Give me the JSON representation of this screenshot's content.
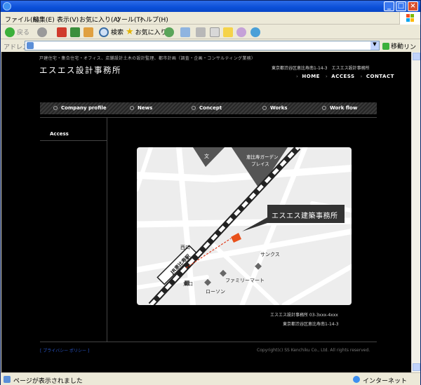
{
  "browser": {
    "menu": [
      "ファイル(F)",
      "編集(E)",
      "表示(V)",
      "お気に入り(A)",
      "ツール(T)",
      "ヘルプ(H)"
    ],
    "toolbar": {
      "back": "戻る",
      "search": "検索",
      "favorites": "お気に入り"
    },
    "address_label": "アドレス(D)",
    "address_value": "",
    "go_label": "移動",
    "links_label": "リンク",
    "status_text": "ページが表示されました",
    "zone_text": "インターネット"
  },
  "site": {
    "tagline": "戸建住宅・集合住宅・オフィス、店舗設計土木の設計監理、都市計画（調査・企画・コンサルティング業務）",
    "logo": "エスエス設計事務所",
    "address_top": "東京都渋谷区恵比寿南1-14-3　エスエス設計事務所",
    "topnav": [
      "HOME",
      "ACCESS",
      "CONTACT"
    ],
    "nav": [
      "Company profile",
      "News",
      "Concept",
      "Works",
      "Work flow"
    ],
    "sidebar_title": "Access",
    "map": {
      "school_label": "文",
      "garden_label_1": "恵比寿ガーデン",
      "garden_label_2": "プレイス",
      "office_label": "エスエス建築事務所",
      "west_exit": "西口",
      "east_exit": "東口",
      "station": "JR恵比寿駅",
      "sunkus": "サンクス",
      "familymart": "ファミリーマート",
      "lawson": "ローソン"
    },
    "info_line1": "エスエス設計事務所 03-3xxx-4xxx",
    "info_line2": "東京都渋谷区恵比寿南1-14-3",
    "footer_link": "[ プライバシー ポリシー ]",
    "copyright": "Copyright(c) SS Kenchiku Co., Ltd. All rights reserved."
  }
}
